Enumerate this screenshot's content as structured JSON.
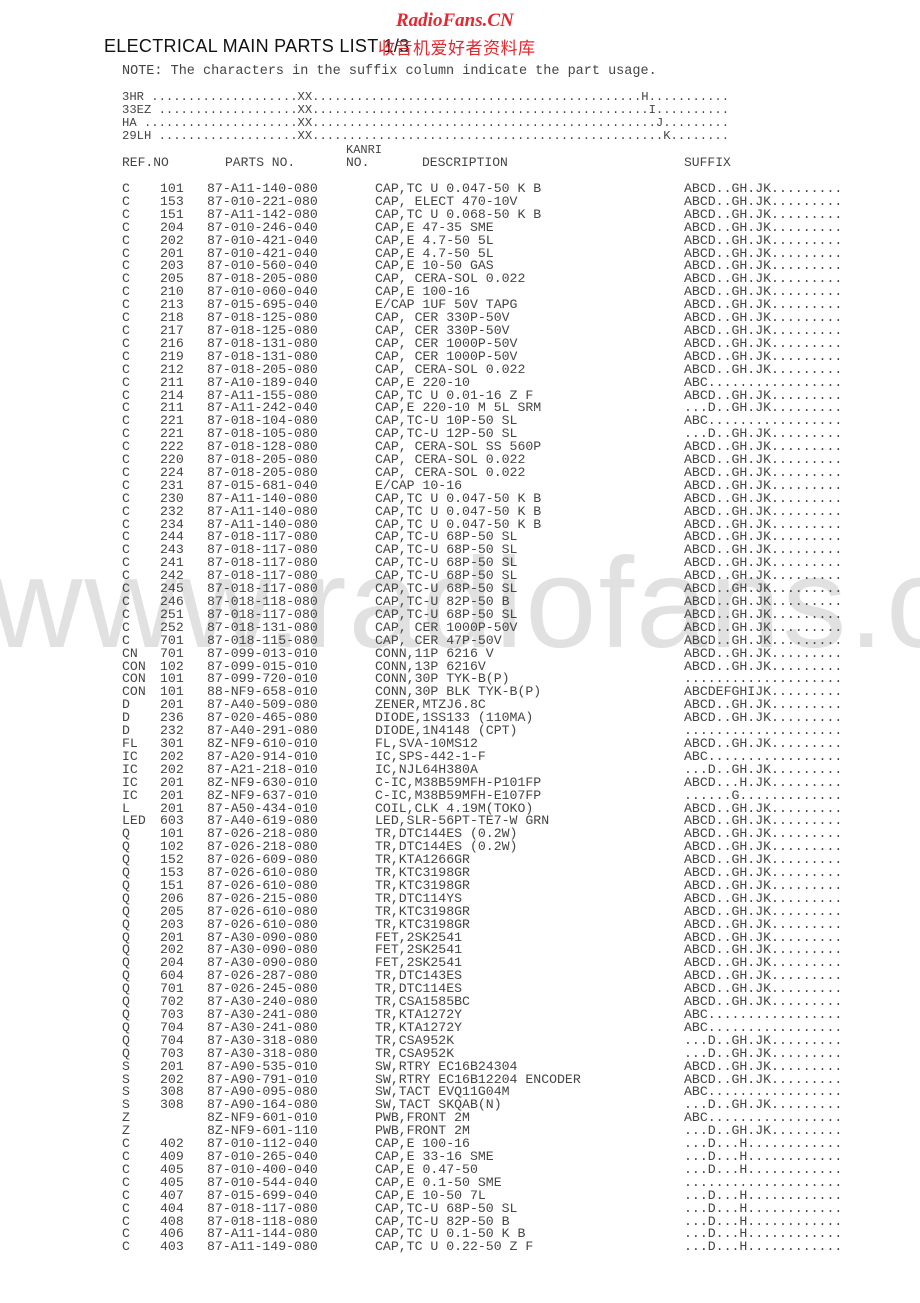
{
  "watermark": {
    "site": "RadioFans.CN",
    "cn": "收音机爱好者资料库",
    "big": "www.radiofans.cn"
  },
  "title": "ELECTRICAL MAIN PARTS LIST 1/3",
  "note": "NOTE: The characters in the suffix column indicate the part usage.",
  "legend": [
    "3HR ....................XX.............................................H...........",
    "33EZ ...................XX..............................................I..........",
    "HA .....................XX...............................................J.........",
    "29LH ...................XX................................................K........"
  ],
  "headers": {
    "kanri": "KANRI",
    "ref": "REF.NO",
    "parts": "PARTS NO.",
    "no": "NO.",
    "desc": "DESCRIPTION",
    "suffix": "SUFFIX"
  },
  "rows": [
    {
      "ref": "C",
      "num": "101",
      "part": "87-A11-140-080",
      "desc": "CAP,TC U 0.047-50 K B",
      "suf": "ABCD..GH.JK........."
    },
    {
      "ref": "C",
      "num": "153",
      "part": "87-010-221-080",
      "desc": "CAP, ELECT 470-10V",
      "suf": "ABCD..GH.JK........."
    },
    {
      "ref": "C",
      "num": "151",
      "part": "87-A11-142-080",
      "desc": "CAP,TC U 0.068-50 K B",
      "suf": "ABCD..GH.JK........."
    },
    {
      "ref": "C",
      "num": "204",
      "part": "87-010-246-040",
      "desc": "CAP,E 47-35 SME",
      "suf": "ABCD..GH.JK........."
    },
    {
      "ref": "C",
      "num": "202",
      "part": "87-010-421-040",
      "desc": "CAP,E 4.7-50 5L",
      "suf": "ABCD..GH.JK........."
    },
    {
      "ref": "C",
      "num": "201",
      "part": "87-010-421-040",
      "desc": "CAP,E 4.7-50 5L",
      "suf": "ABCD..GH.JK........."
    },
    {
      "ref": "C",
      "num": "203",
      "part": "87-010-560-040",
      "desc": "CAP,E 10-50 GAS",
      "suf": "ABCD..GH.JK........."
    },
    {
      "ref": "C",
      "num": "205",
      "part": "87-018-205-080",
      "desc": "CAP, CERA-SOL 0.022",
      "suf": "ABCD..GH.JK........."
    },
    {
      "ref": "C",
      "num": "210",
      "part": "87-010-060-040",
      "desc": "CAP,E 100-16",
      "suf": "ABCD..GH.JK........."
    },
    {
      "ref": "C",
      "num": "213",
      "part": "87-015-695-040",
      "desc": "E/CAP 1UF 50V TAPG",
      "suf": "ABCD..GH.JK........."
    },
    {
      "ref": "C",
      "num": "218",
      "part": "87-018-125-080",
      "desc": "CAP, CER 330P-50V",
      "suf": "ABCD..GH.JK........."
    },
    {
      "ref": "C",
      "num": "217",
      "part": "87-018-125-080",
      "desc": "CAP, CER 330P-50V",
      "suf": "ABCD..GH.JK........."
    },
    {
      "ref": "C",
      "num": "216",
      "part": "87-018-131-080",
      "desc": "CAP, CER 1000P-50V",
      "suf": "ABCD..GH.JK........."
    },
    {
      "ref": "C",
      "num": "219",
      "part": "87-018-131-080",
      "desc": "CAP, CER 1000P-50V",
      "suf": "ABCD..GH.JK........."
    },
    {
      "ref": "C",
      "num": "212",
      "part": "87-018-205-080",
      "desc": "CAP, CERA-SOL 0.022",
      "suf": "ABCD..GH.JK........."
    },
    {
      "ref": "C",
      "num": "211",
      "part": "87-A10-189-040",
      "desc": "CAP,E 220-10",
      "suf": "ABC................."
    },
    {
      "ref": "C",
      "num": "214",
      "part": "87-A11-155-080",
      "desc": "CAP,TC U 0.01-16 Z F",
      "suf": "ABCD..GH.JK........."
    },
    {
      "ref": "C",
      "num": "211",
      "part": "87-A11-242-040",
      "desc": "CAP,E 220-10 M 5L SRM",
      "suf": "...D..GH.JK........."
    },
    {
      "ref": "C",
      "num": "221",
      "part": "87-018-104-080",
      "desc": "CAP,TC-U 10P-50 SL",
      "suf": "ABC................."
    },
    {
      "ref": "C",
      "num": "221",
      "part": "87-018-105-080",
      "desc": "CAP,TC-U 12P-50 SL",
      "suf": "...D..GH.JK........."
    },
    {
      "ref": "C",
      "num": "222",
      "part": "87-018-128-080",
      "desc": "CAP, CERA-SOL SS 560P",
      "suf": "ABCD..GH.JK........."
    },
    {
      "ref": "C",
      "num": "220",
      "part": "87-018-205-080",
      "desc": "CAP, CERA-SOL 0.022",
      "suf": "ABCD..GH.JK........."
    },
    {
      "ref": "C",
      "num": "224",
      "part": "87-018-205-080",
      "desc": "CAP, CERA-SOL 0.022",
      "suf": "ABCD..GH.JK........."
    },
    {
      "ref": "C",
      "num": "231",
      "part": "87-015-681-040",
      "desc": "E/CAP 10-16",
      "suf": "ABCD..GH.JK........."
    },
    {
      "ref": "C",
      "num": "230",
      "part": "87-A11-140-080",
      "desc": "CAP,TC U 0.047-50 K B",
      "suf": "ABCD..GH.JK........."
    },
    {
      "ref": "C",
      "num": "232",
      "part": "87-A11-140-080",
      "desc": "CAP,TC U 0.047-50 K B",
      "suf": "ABCD..GH.JK........."
    },
    {
      "ref": "C",
      "num": "234",
      "part": "87-A11-140-080",
      "desc": "CAP,TC U 0.047-50 K B",
      "suf": "ABCD..GH.JK........."
    },
    {
      "ref": "C",
      "num": "244",
      "part": "87-018-117-080",
      "desc": "CAP,TC-U 68P-50 SL",
      "suf": "ABCD..GH.JK........."
    },
    {
      "ref": "C",
      "num": "243",
      "part": "87-018-117-080",
      "desc": "CAP,TC-U 68P-50 SL",
      "suf": "ABCD..GH.JK........."
    },
    {
      "ref": "C",
      "num": "241",
      "part": "87-018-117-080",
      "desc": "CAP,TC-U 68P-50 SL",
      "suf": "ABCD..GH.JK........."
    },
    {
      "ref": "C",
      "num": "242",
      "part": "87-018-117-080",
      "desc": "CAP,TC-U 68P-50 SL",
      "suf": "ABCD..GH.JK........."
    },
    {
      "ref": "C",
      "num": "245",
      "part": "87-018-117-080",
      "desc": "CAP,TC-U 68P-50 SL",
      "suf": "ABCD..GH.JK........."
    },
    {
      "ref": "C",
      "num": "246",
      "part": "87-018-118-080",
      "desc": "CAP,TC-U 82P-50 B",
      "suf": "ABCD..GH.JK........."
    },
    {
      "ref": "C",
      "num": "251",
      "part": "87-018-117-080",
      "desc": "CAP,TC-U 68P-50 SL",
      "suf": "ABCD..GH.JK........."
    },
    {
      "ref": "C",
      "num": "252",
      "part": "87-018-131-080",
      "desc": "CAP, CER 1000P-50V",
      "suf": "ABCD..GH.JK........."
    },
    {
      "ref": "C",
      "num": "701",
      "part": "87-018-115-080",
      "desc": "CAP, CER 47P-50V",
      "suf": "ABCD..GH.JK........."
    },
    {
      "ref": "CN",
      "num": "701",
      "part": "87-099-013-010",
      "desc": "CONN,11P 6216 V",
      "suf": "ABCD..GH.JK........."
    },
    {
      "ref": "CON",
      "num": "102",
      "part": "87-099-015-010",
      "desc": "CONN,13P 6216V",
      "suf": "ABCD..GH.JK........."
    },
    {
      "ref": "CON",
      "num": "101",
      "part": "87-099-720-010",
      "desc": "CONN,30P TYK-B(P)",
      "suf": "...................."
    },
    {
      "ref": "CON",
      "num": "101",
      "part": "88-NF9-658-010",
      "desc": "CONN,30P BLK TYK-B(P)",
      "suf": "ABCDEFGHIJK........."
    },
    {
      "ref": "D",
      "num": "201",
      "part": "87-A40-509-080",
      "desc": "ZENER,MTZJ6.8C",
      "suf": "ABCD..GH.JK........."
    },
    {
      "ref": "D",
      "num": "236",
      "part": "87-020-465-080",
      "desc": "DIODE,1SS133 (110MA)",
      "suf": "ABCD..GH.JK........."
    },
    {
      "ref": "D",
      "num": "232",
      "part": "87-A40-291-080",
      "desc": "DIODE,1N4148 (CPT)",
      "suf": "...................."
    },
    {
      "ref": "FL",
      "num": "301",
      "part": "8Z-NF9-610-010",
      "desc": "FL,SVA-10MS12",
      "suf": "ABCD..GH.JK........."
    },
    {
      "ref": "IC",
      "num": "202",
      "part": "87-A20-914-010",
      "desc": "IC,SPS-442-1-F",
      "suf": "ABC................."
    },
    {
      "ref": "IC",
      "num": "202",
      "part": "87-A21-218-010",
      "desc": "IC,NJL64H380A",
      "suf": "...D..GH.JK........."
    },
    {
      "ref": "IC",
      "num": "201",
      "part": "8Z-NF9-630-010",
      "desc": "C-IC,M38B59MFH-P101FP",
      "suf": "ABCD...H.JK........."
    },
    {
      "ref": "IC",
      "num": "201",
      "part": "8Z-NF9-637-010",
      "desc": "C-IC,M38B59MFH-E107FP",
      "suf": "......G............."
    },
    {
      "ref": "L",
      "num": "201",
      "part": "87-A50-434-010",
      "desc": "COIL,CLK 4.19M(TOKO)",
      "suf": "ABCD..GH.JK........."
    },
    {
      "ref": "LED",
      "num": "603",
      "part": "87-A40-619-080",
      "desc": "LED,SLR-56PT-TE7-W GRN",
      "suf": "ABCD..GH.JK........."
    },
    {
      "ref": "Q",
      "num": "101",
      "part": "87-026-218-080",
      "desc": "TR,DTC144ES (0.2W)",
      "suf": "ABCD..GH.JK........."
    },
    {
      "ref": "Q",
      "num": "102",
      "part": "87-026-218-080",
      "desc": "TR,DTC144ES (0.2W)",
      "suf": "ABCD..GH.JK........."
    },
    {
      "ref": "Q",
      "num": "152",
      "part": "87-026-609-080",
      "desc": "TR,KTA1266GR",
      "suf": "ABCD..GH.JK........."
    },
    {
      "ref": "Q",
      "num": "153",
      "part": "87-026-610-080",
      "desc": "TR,KTC3198GR",
      "suf": "ABCD..GH.JK........."
    },
    {
      "ref": "Q",
      "num": "151",
      "part": "87-026-610-080",
      "desc": "TR,KTC3198GR",
      "suf": "ABCD..GH.JK........."
    },
    {
      "ref": "Q",
      "num": "206",
      "part": "87-026-215-080",
      "desc": "TR,DTC114YS",
      "suf": "ABCD..GH.JK........."
    },
    {
      "ref": "Q",
      "num": "205",
      "part": "87-026-610-080",
      "desc": "TR,KTC3198GR",
      "suf": "ABCD..GH.JK........."
    },
    {
      "ref": "Q",
      "num": "203",
      "part": "87-026-610-080",
      "desc": "TR,KTC3198GR",
      "suf": "ABCD..GH.JK........."
    },
    {
      "ref": "Q",
      "num": "201",
      "part": "87-A30-090-080",
      "desc": "FET,2SK2541",
      "suf": "ABCD..GH.JK........."
    },
    {
      "ref": "Q",
      "num": "202",
      "part": "87-A30-090-080",
      "desc": "FET,2SK2541",
      "suf": "ABCD..GH.JK........."
    },
    {
      "ref": "Q",
      "num": "204",
      "part": "87-A30-090-080",
      "desc": "FET,2SK2541",
      "suf": "ABCD..GH.JK........."
    },
    {
      "ref": "Q",
      "num": "604",
      "part": "87-026-287-080",
      "desc": "TR,DTC143ES",
      "suf": "ABCD..GH.JK........."
    },
    {
      "ref": "Q",
      "num": "701",
      "part": "87-026-245-080",
      "desc": "TR,DTC114ES",
      "suf": "ABCD..GH.JK........."
    },
    {
      "ref": "Q",
      "num": "702",
      "part": "87-A30-240-080",
      "desc": "TR,CSA1585BC",
      "suf": "ABCD..GH.JK........."
    },
    {
      "ref": "Q",
      "num": "703",
      "part": "87-A30-241-080",
      "desc": "TR,KTA1272Y",
      "suf": "ABC................."
    },
    {
      "ref": "Q",
      "num": "704",
      "part": "87-A30-241-080",
      "desc": "TR,KTA1272Y",
      "suf": "ABC................."
    },
    {
      "ref": "Q",
      "num": "704",
      "part": "87-A30-318-080",
      "desc": "TR,CSA952K",
      "suf": "...D..GH.JK........."
    },
    {
      "ref": "Q",
      "num": "703",
      "part": "87-A30-318-080",
      "desc": "TR,CSA952K",
      "suf": "...D..GH.JK........."
    },
    {
      "ref": "S",
      "num": "201",
      "part": "87-A90-535-010",
      "desc": "SW,RTRY EC16B24304",
      "suf": "ABCD..GH.JK........."
    },
    {
      "ref": "S",
      "num": "202",
      "part": "87-A90-791-010",
      "desc": "SW,RTRY EC16B12204 ENCODER",
      "suf": "ABCD..GH.JK........."
    },
    {
      "ref": "S",
      "num": "308",
      "part": "87-A90-095-080",
      "desc": "SW,TACT EVQ11G04M",
      "suf": "ABC................."
    },
    {
      "ref": "S",
      "num": "308",
      "part": "87-A90-164-080",
      "desc": "SW,TACT SKQAB(N)",
      "suf": "...D..GH.JK........."
    },
    {
      "ref": "Z",
      "num": "",
      "part": "8Z-NF9-601-010",
      "desc": "PWB,FRONT 2M",
      "suf": "ABC................."
    },
    {
      "ref": "Z",
      "num": "",
      "part": "8Z-NF9-601-110",
      "desc": "PWB,FRONT 2M",
      "suf": "...D..GH.JK........."
    },
    {
      "ref": "C",
      "num": "402",
      "part": "87-010-112-040",
      "desc": "CAP,E 100-16",
      "suf": "...D...H............"
    },
    {
      "ref": "C",
      "num": "409",
      "part": "87-010-265-040",
      "desc": "CAP,E 33-16 SME",
      "suf": "...D...H............"
    },
    {
      "ref": "C",
      "num": "405",
      "part": "87-010-400-040",
      "desc": "CAP,E 0.47-50",
      "suf": "...D...H............"
    },
    {
      "ref": "C",
      "num": "405",
      "part": "87-010-544-040",
      "desc": "CAP,E 0.1-50 SME",
      "suf": "...................."
    },
    {
      "ref": "C",
      "num": "407",
      "part": "87-015-699-040",
      "desc": "CAP,E 10-50 7L",
      "suf": "...D...H............"
    },
    {
      "ref": "C",
      "num": "404",
      "part": "87-018-117-080",
      "desc": "CAP,TC-U 68P-50 SL",
      "suf": "...D...H............"
    },
    {
      "ref": "C",
      "num": "408",
      "part": "87-018-118-080",
      "desc": "CAP,TC-U 82P-50 B",
      "suf": "...D...H............"
    },
    {
      "ref": "C",
      "num": "406",
      "part": "87-A11-144-080",
      "desc": "CAP,TC U 0.1-50 K B",
      "suf": "...D...H............"
    },
    {
      "ref": "C",
      "num": "403",
      "part": "87-A11-149-080",
      "desc": "CAP,TC U 0.22-50 Z F",
      "suf": "...D...H............"
    }
  ]
}
